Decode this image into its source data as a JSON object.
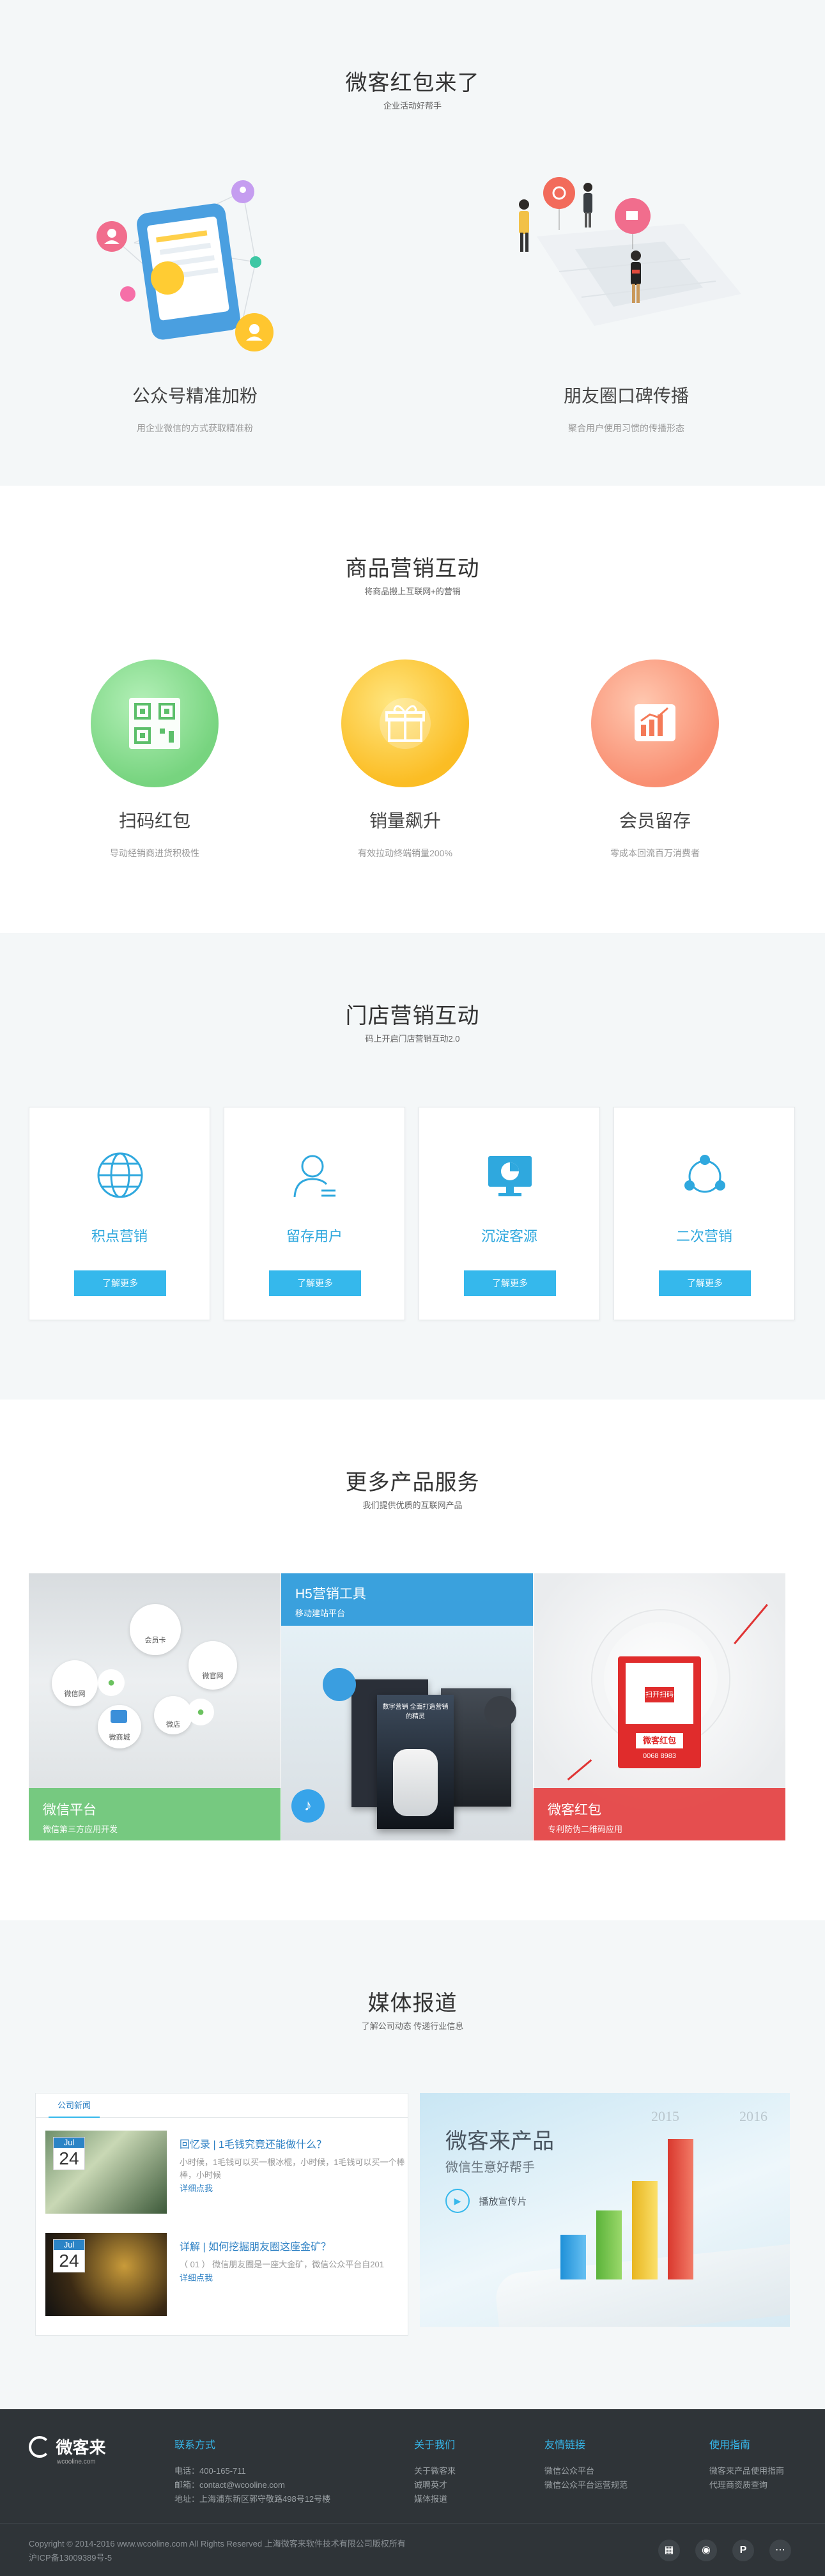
{
  "hero": {
    "title": "微客红包来了",
    "subtitle": "企业活动好帮手",
    "features": [
      {
        "title": "公众号精准加粉",
        "desc": "用企业微信的方式获取精准粉"
      },
      {
        "title": "朋友圈口碑传播",
        "desc": "聚合用户使用习惯的传播形态"
      }
    ]
  },
  "goods": {
    "title": "商品营销互动",
    "subtitle": "将商品搬上互联网+的营销",
    "items": [
      {
        "title": "扫码红包",
        "desc": "导动经销商进货积极性"
      },
      {
        "title": "销量飙升",
        "desc": "有效拉动终端销量200%"
      },
      {
        "title": "会员留存",
        "desc": "零成本回流百万消费者"
      }
    ]
  },
  "store": {
    "title": "门店营销互动",
    "subtitle": "码上开启门店营销互动2.0",
    "cards": [
      {
        "label": "积点营销",
        "button": "了解更多"
      },
      {
        "label": "留存用户",
        "button": "了解更多"
      },
      {
        "label": "沉淀客源",
        "button": "了解更多"
      },
      {
        "label": "二次营销",
        "button": "了解更多"
      }
    ]
  },
  "more": {
    "title": "更多产品服务",
    "subtitle": "我们提供优质的互联网产品",
    "products": [
      {
        "title": "微信平台",
        "desc": "微信第三方应用开发",
        "bubbles": [
          "会员卡",
          "微信网",
          "微官网",
          "微店",
          "微商城"
        ]
      },
      {
        "title": "H5营销工具",
        "desc": "移动建站平台",
        "poster": "数字营销 全面打造营销的精灵"
      },
      {
        "title": "微客红包",
        "desc": "专利防伪二维码应用",
        "qr_top": "扫开扫码",
        "qr_bottom": "微客红包",
        "qr_code": "0068 8983"
      }
    ]
  },
  "media": {
    "title": "媒体报道",
    "subtitle": "了解公司动态 传递行业信息",
    "tab": "公司新闻",
    "news": [
      {
        "month": "Jul",
        "day": "24",
        "headline": "回忆录 | 1毛钱究竟还能做什么？",
        "summary": "小时候，1毛钱可以买一根冰棍，小时候，1毛钱可以买一个棒棒，小时候",
        "more": "详细点我"
      },
      {
        "month": "Jul",
        "day": "24",
        "headline": "详解 | 如何挖掘朋友圈这座金矿？",
        "summary": "（ 01 ） 微信朋友圈是一座大金矿，微信公众平台自201",
        "more": "详细点我"
      }
    ],
    "banner": {
      "title": "微客来产品",
      "subtitle": "微信生意好帮手",
      "button": "播放宣传片",
      "years": [
        "2015",
        "2016"
      ]
    }
  },
  "footer": {
    "logo": "微客来",
    "logo_sub": "wcooline.com",
    "contact": {
      "head": "联系方式",
      "lines": [
        "电话：400-165-711",
        "邮箱：contact@wcooline.com",
        "地址：上海浦东新区郭守敬路498号12号楼"
      ]
    },
    "about": {
      "head": "关于我们",
      "lines": [
        "关于微客来",
        "诚聘英才",
        "媒体报道"
      ]
    },
    "links": {
      "head": "友情链接",
      "lines": [
        "微信公众平台",
        "微信公众平台运营规范"
      ]
    },
    "guide": {
      "head": "使用指南",
      "lines": [
        "微客来产品使用指南",
        "代理商资质查询"
      ]
    },
    "copyright": "Copyright © 2014-2016 www.wcooline.com All Rights Reserved 上海微客来软件技术有限公司版权所有",
    "icp": "沪ICP备13009389号-5"
  },
  "colors": {
    "accent": "#35b8ec",
    "footer_bg": "#2f3438",
    "section_gray": "#f4f7f8"
  }
}
